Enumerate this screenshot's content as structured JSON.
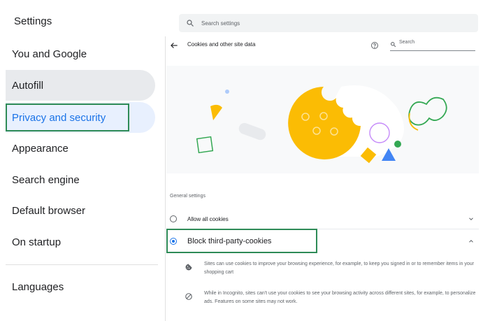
{
  "header": {
    "app_title": "Settings",
    "search_placeholder": "Search settings",
    "search_icon": "search-icon"
  },
  "sidebar": {
    "items": [
      {
        "label": "You and Google",
        "state": "default"
      },
      {
        "label": "Autofill",
        "state": "hover"
      },
      {
        "label": "Privacy and security",
        "state": "selected"
      },
      {
        "label": "Appearance",
        "state": "default"
      },
      {
        "label": "Search engine",
        "state": "default"
      },
      {
        "label": "Default browser",
        "state": "default"
      },
      {
        "label": "On startup",
        "state": "default"
      },
      {
        "label": "Languages",
        "state": "default"
      }
    ]
  },
  "panel": {
    "back_icon": "arrow-back-icon",
    "title": "Cookies and other site data",
    "help_icon": "help-circle-icon",
    "search_placeholder": "Search",
    "search_icon": "search-icon",
    "section_label": "General settings",
    "options": [
      {
        "label": "Allow all cookies",
        "selected": false,
        "expanded": false
      },
      {
        "label": "Block third-party-cookies",
        "selected": true,
        "expanded": true
      }
    ],
    "details": [
      {
        "icon": "cookie-icon",
        "text": "Sites can use cookies to improve your browsing experience, for example, to keep you signed in or to remember items in your shopping cart"
      },
      {
        "icon": "block-icon",
        "text": "While in Incognito, sites can't use your cookies to see your browsing activity across different sites, for example, to personalize ads. Features on some sites may not work."
      }
    ]
  },
  "colors": {
    "accent": "#1a73e8",
    "highlight_box": "#2e8b57",
    "cookie": "#fbbc04",
    "sidebar_selected_bg": "#e8f0fe",
    "sidebar_hover_bg": "#e8eaed"
  }
}
